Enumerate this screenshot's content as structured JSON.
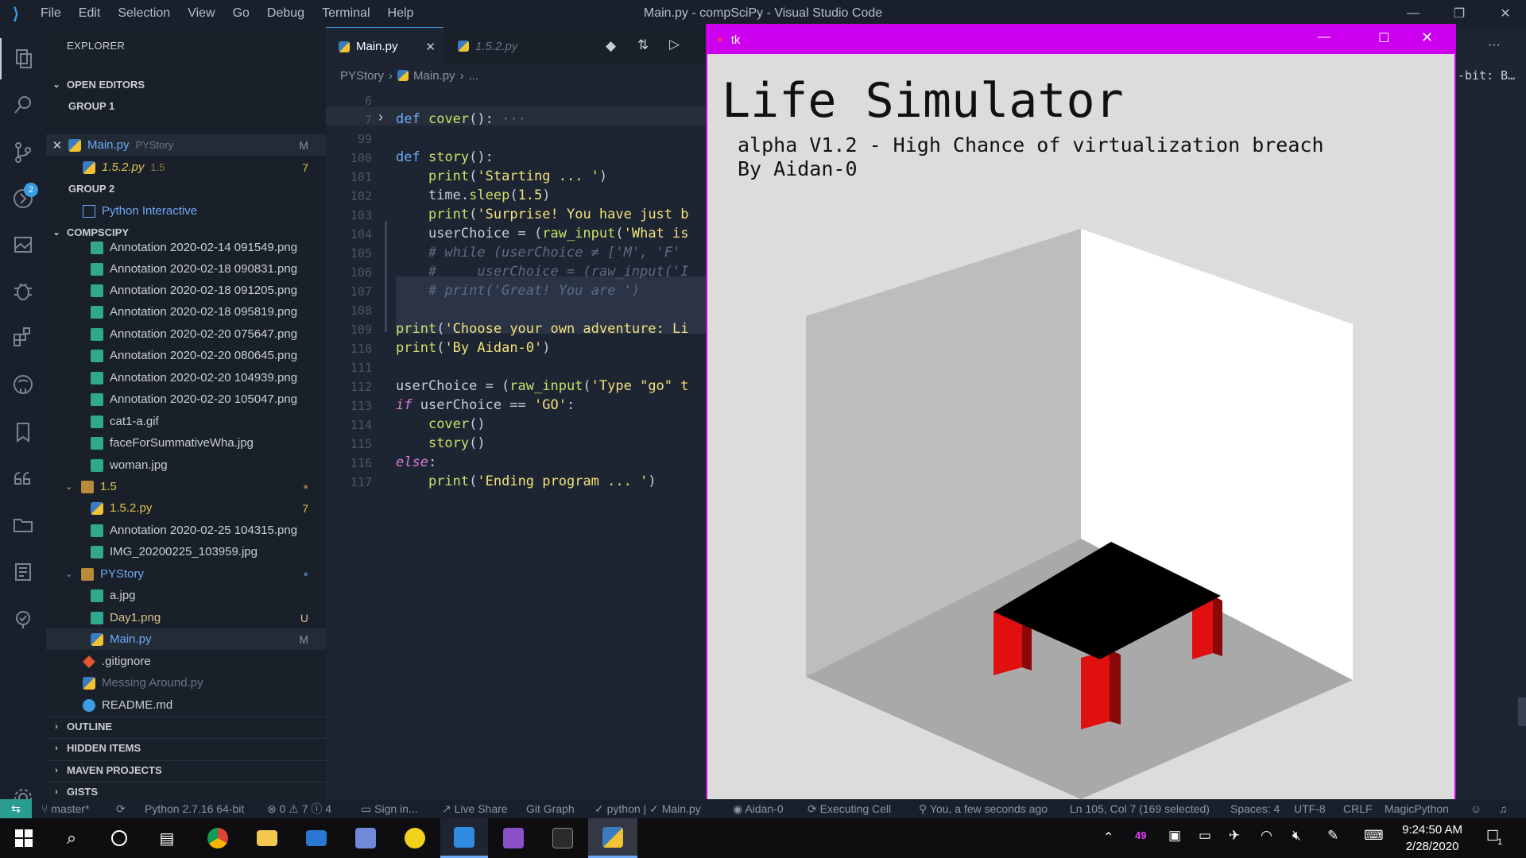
{
  "window": {
    "title": "Main.py - compSciPy - Visual Studio Code"
  },
  "menu": [
    "File",
    "Edit",
    "Selection",
    "View",
    "Go",
    "Debug",
    "Terminal",
    "Help"
  ],
  "sidebar": {
    "header": "EXPLORER",
    "open_editors": "OPEN EDITORS",
    "group1": "GROUP 1",
    "group2": "GROUP 2",
    "open_files": [
      {
        "name": "Main.py",
        "desc": "PYStory",
        "badge": "M"
      },
      {
        "name": "1.5.2.py",
        "desc": "1.5",
        "badge": "7"
      },
      {
        "name": "Python Interactive",
        "desc": "",
        "badge": ""
      }
    ],
    "project": "COMPSCIPY",
    "tree": [
      {
        "name": "Annotation 2020-02-14 091549.png",
        "badge": ""
      },
      {
        "name": "Annotation 2020-02-18 090831.png",
        "badge": ""
      },
      {
        "name": "Annotation 2020-02-18 091205.png",
        "badge": ""
      },
      {
        "name": "Annotation 2020-02-18 095819.png",
        "badge": ""
      },
      {
        "name": "Annotation 2020-02-20 075647.png",
        "badge": ""
      },
      {
        "name": "Annotation 2020-02-20 080645.png",
        "badge": ""
      },
      {
        "name": "Annotation 2020-02-20 104939.png",
        "badge": ""
      },
      {
        "name": "Annotation 2020-02-20 105047.png",
        "badge": ""
      },
      {
        "name": "cat1-a.gif",
        "badge": ""
      },
      {
        "name": "faceForSummativeWha.jpg",
        "badge": ""
      },
      {
        "name": "woman.jpg",
        "badge": ""
      },
      {
        "name": "1.5",
        "badge": "●"
      },
      {
        "name": "1.5.2.py",
        "badge": "7"
      },
      {
        "name": "Annotation 2020-02-25 104315.png",
        "badge": ""
      },
      {
        "name": "IMG_20200225_103959.jpg",
        "badge": ""
      },
      {
        "name": "PYStory",
        "badge": "●"
      },
      {
        "name": "a.jpg",
        "badge": ""
      },
      {
        "name": "Day1.png",
        "badge": "U"
      },
      {
        "name": "Main.py",
        "badge": "M"
      },
      {
        "name": ".gitignore",
        "badge": ""
      },
      {
        "name": "Messing Around.py",
        "badge": ""
      },
      {
        "name": "README.md",
        "badge": ""
      }
    ],
    "bottom_sections": [
      "OUTLINE",
      "HIDDEN ITEMS",
      "MAVEN PROJECTS",
      "GISTS"
    ]
  },
  "tabs": [
    {
      "label": "Main.py",
      "active": true
    },
    {
      "label": "1.5.2.py",
      "active": false
    }
  ],
  "breadcrumb": [
    "PYStory",
    "Main.py",
    "..."
  ],
  "editor": {
    "lines": [
      {
        "n": "6",
        "code": ""
      },
      {
        "n": "7",
        "code": "def cover(): ···"
      },
      {
        "n": "99",
        "code": ""
      },
      {
        "n": "100",
        "code": "def story():"
      },
      {
        "n": "101",
        "code": "    print('Starting ... ')"
      },
      {
        "n": "102",
        "code": "    time.sleep(1.5)"
      },
      {
        "n": "103",
        "code": "    print('Surprise! You have just b"
      },
      {
        "n": "104",
        "code": "    userChoice = (raw_input('What is"
      },
      {
        "n": "105",
        "code": "    # while (userChoice ≠ ['M', 'F'"
      },
      {
        "n": "106",
        "code": "    #     userChoice = (raw_input('I"
      },
      {
        "n": "107",
        "code": "    # print('Great! You are ')"
      },
      {
        "n": "108",
        "code": ""
      },
      {
        "n": "109",
        "code": "print('Choose your own adventure: Li"
      },
      {
        "n": "110",
        "code": "print('By Aidan-0')"
      },
      {
        "n": "111",
        "code": ""
      },
      {
        "n": "112",
        "code": "userChoice = (raw_input('Type \"go\" t"
      },
      {
        "n": "113",
        "code": "if userChoice == 'GO':"
      },
      {
        "n": "114",
        "code": "    cover()"
      },
      {
        "n": "115",
        "code": "    story()"
      },
      {
        "n": "116",
        "code": "else:"
      },
      {
        "n": "117",
        "code": "    print('Ending program ... ')"
      }
    ]
  },
  "right_panel_text": "-bit: B…",
  "tk": {
    "title": "tk",
    "heading": "Life Simulator",
    "subtitle": "alpha V1.2 - High Chance of virtualization breach",
    "author": "By Aidan-0"
  },
  "status": {
    "branch": "master*",
    "python": "Python 2.7.16 64-bit",
    "problems": "⊗ 0 ⚠ 7 ⓘ 4",
    "sign_in": "Sign in...",
    "live_share": "Live Share",
    "git_graph": "Git Graph",
    "checks": "✓ python | ✓ Main.py",
    "user": "Aidan-0",
    "executing": "Executing Cell",
    "blame": "You, a few seconds ago",
    "position": "Ln 105, Col 7 (169 selected)",
    "spaces": "Spaces: 4",
    "encoding": "UTF-8",
    "eol": "CRLF",
    "language": "MagicPython"
  },
  "taskbar": {
    "time": "9:24:50 AM",
    "date": "2/28/2020",
    "tray_number": "49",
    "notification_count": "1"
  },
  "colors": {
    "accent": "#3b9be5",
    "tk_titlebar": "#cc00ee",
    "table_leg": "#e01010"
  }
}
